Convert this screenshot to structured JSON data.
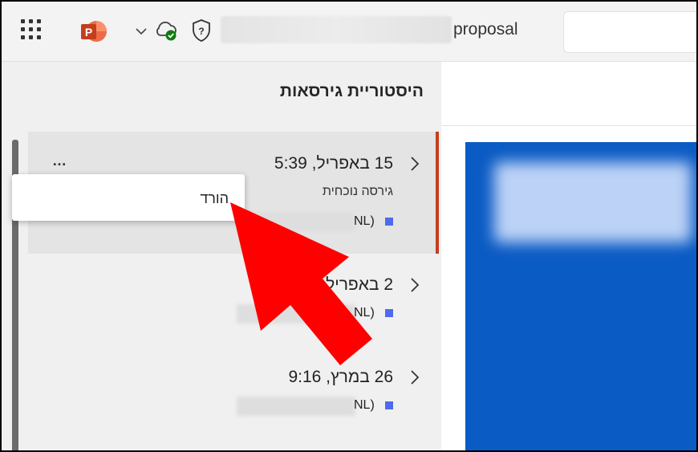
{
  "header": {
    "doc_title": "proposal",
    "icons": [
      "waffle-icon",
      "powerpoint-icon",
      "chevron-down-icon",
      "cloud-saved-icon",
      "shield-icon"
    ],
    "brand_color": "#c43e1c"
  },
  "panel": {
    "title": "היסטוריית גירסאות",
    "versions": [
      {
        "date": "15 באפריל, 5:39",
        "status": "גירסה נוכחית",
        "author": "NL)",
        "more": "…"
      },
      {
        "date": "2 באפריל",
        "author": "NL)"
      },
      {
        "date": "26 במרץ, 9:16",
        "author": "NL)"
      }
    ]
  },
  "context_menu": {
    "items": [
      "הורד"
    ]
  },
  "annotation": {
    "arrow_color": "#ff0000"
  },
  "slide": {
    "background_color": "#0b5bc4"
  }
}
